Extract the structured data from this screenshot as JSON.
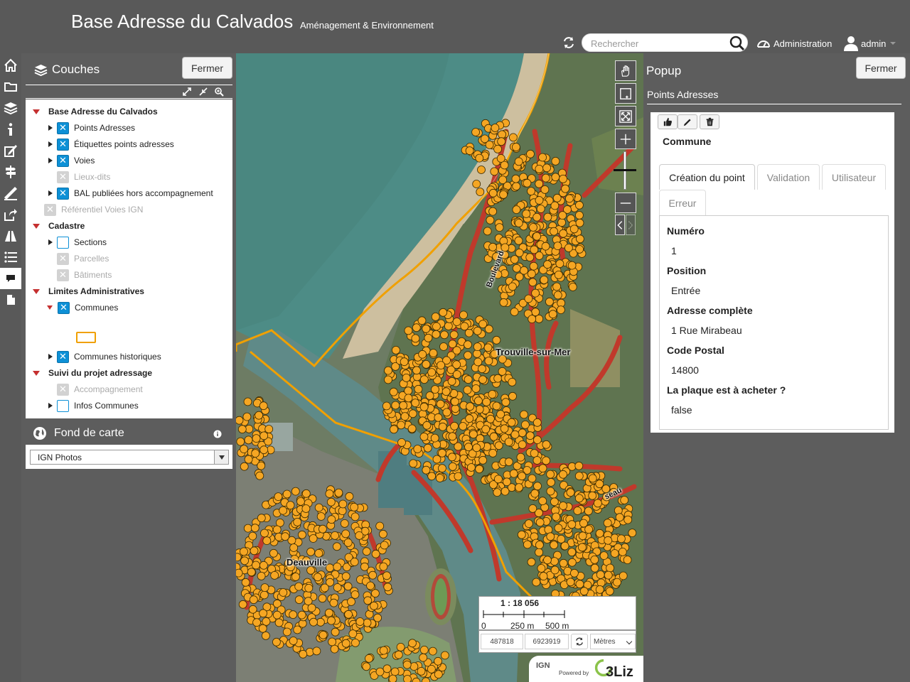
{
  "header": {
    "title": "Base Adresse du Calvados",
    "subtitle": "Aménagement & Environnement",
    "search_placeholder": "Rechercher",
    "admin_label": "Administration",
    "user_label": "admin"
  },
  "dock": {
    "icons": [
      "home-icon",
      "folder-icon",
      "layers-icon",
      "info-icon",
      "edit-icon",
      "location-icon",
      "measure-icon",
      "share-icon",
      "dataviz-icon",
      "list-icon",
      "comment-icon",
      "file-icon"
    ],
    "active": "comment-icon"
  },
  "layers": {
    "title": "Couches",
    "close_label": "Fermer",
    "tree": [
      {
        "label": "Base Adresse du Calvados",
        "type": "group"
      },
      {
        "label": "Points Adresses",
        "state": "on"
      },
      {
        "label": "Étiquettes points adresses",
        "state": "on"
      },
      {
        "label": "Voies",
        "state": "on"
      },
      {
        "label": "Lieux-dits",
        "state": "disabled"
      },
      {
        "label": "BAL publiées hors accompagnement",
        "state": "on"
      },
      {
        "label": "Référentiel Voies IGN",
        "state": "disabled"
      },
      {
        "label": "Cadastre",
        "type": "group"
      },
      {
        "label": "Sections",
        "state": "off"
      },
      {
        "label": "Parcelles",
        "state": "disabled"
      },
      {
        "label": "Bâtiments",
        "state": "disabled"
      },
      {
        "label": "Limites Administratives",
        "type": "group"
      },
      {
        "label": "Communes",
        "state": "on"
      },
      {
        "label": "Communes historiques",
        "state": "on"
      },
      {
        "label": "Suivi du projet adressage",
        "type": "group"
      },
      {
        "label": "Accompagnement",
        "state": "disabled"
      },
      {
        "label": "Infos Communes",
        "state": "off"
      }
    ]
  },
  "basemap": {
    "title": "Fond de carte",
    "selected": "IGN Photos"
  },
  "map": {
    "labels": {
      "town1": "Trouville-sur-Mer",
      "town2": "Deauville",
      "street1": "Boulevard",
      "street2": "seau"
    },
    "scale_label": "1 : 18 056",
    "scale_ticks": [
      "0",
      "250 m",
      "500 m"
    ],
    "coord_x": "487818",
    "coord_y": "6923919",
    "unit": "Mètres",
    "logo_ign": "IGN",
    "logo_powered": "Powered by",
    "logo_3liz": "3Liz"
  },
  "popup": {
    "title": "Popup",
    "close_label": "Fermer",
    "layer_title": "Points Adresses",
    "feature_title": "Commune",
    "tabs": [
      "Création du point",
      "Validation",
      "Utilisateur",
      "Erreur"
    ],
    "fields": [
      {
        "label": "Numéro",
        "value": "1"
      },
      {
        "label": "Position",
        "value": "Entrée"
      },
      {
        "label": "Adresse complète",
        "value": "1 Rue Mirabeau"
      },
      {
        "label": "Code Postal",
        "value": "14800"
      },
      {
        "label": "La plaque est à acheter ?",
        "value": "false"
      }
    ]
  },
  "colors": {
    "header_bg": "#595959",
    "checkbox_blue": "#0d90d6",
    "point_orange": "#f5a623",
    "road_red": "#c0392b",
    "boundary_orange": "#f0a000"
  }
}
